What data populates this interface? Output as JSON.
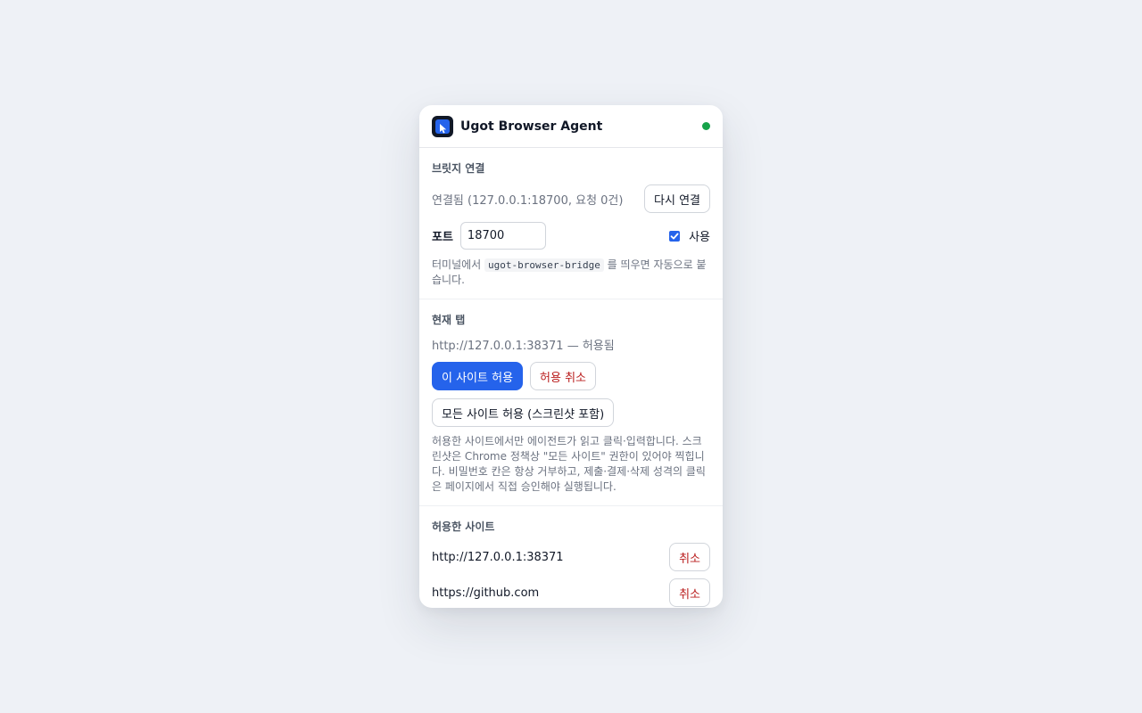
{
  "header": {
    "title": "Ugot Browser Agent",
    "status_color": "#16a34a",
    "logo_icon": "cursor-icon"
  },
  "bridge": {
    "title": "브릿지 연결",
    "status": "연결됨 (127.0.0.1:18700, 요청 0건)",
    "reconnect_label": "다시 연결",
    "port_label": "포트",
    "port_value": "18700",
    "enabled_label": "사용",
    "enabled": true,
    "hint_before": "터미널에서 ",
    "hint_code": "ugot-browser-bridge",
    "hint_after": " 를 띄우면 자동으로 붙습니다."
  },
  "current_tab": {
    "title": "현재 탭",
    "url_status": "http://127.0.0.1:38371 — 허용됨",
    "allow_site_label": "이 사이트 허용",
    "revoke_label": "허용 취소",
    "allow_all_label": "모든 사이트 허용 (스크린샷 포함)",
    "hint": "허용한 사이트에서만 에이전트가 읽고 클릭·입력합니다. 스크린샷은 Chrome 정책상 \"모든 사이트\" 권한이 있어야 찍힙니다. 비밀번호 칸은 항상 거부하고, 제출·결제·삭제 성격의 클릭은 페이지에서 직접 승인해야 실행됩니다."
  },
  "allowed_sites": {
    "title": "허용한 사이트",
    "items": [
      {
        "url": "http://127.0.0.1:38371",
        "cancel_label": "취소"
      },
      {
        "url": "https://github.com",
        "cancel_label": "취소"
      }
    ]
  },
  "colors": {
    "primary": "#2563eb",
    "danger": "#b91c1c",
    "background": "#eef1f6"
  }
}
